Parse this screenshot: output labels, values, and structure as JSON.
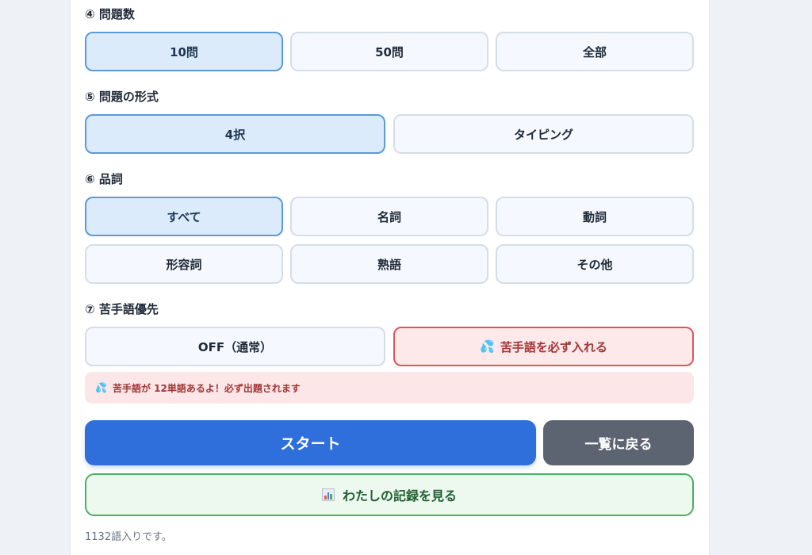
{
  "sections": {
    "count": {
      "title": "④ 問題数",
      "options": [
        "10問",
        "50問",
        "全部"
      ],
      "selected": "10問"
    },
    "format": {
      "title": "⑤ 問題の形式",
      "options": [
        "4択",
        "タイピング"
      ],
      "selected": "4択"
    },
    "pos": {
      "title": "⑥ 品詞",
      "options": [
        "すべて",
        "名詞",
        "動詞",
        "形容詞",
        "熟語",
        "その他"
      ],
      "selected": "すべて"
    },
    "weak": {
      "title": "⑦ 苦手語優先",
      "off_label": "OFF（通常）",
      "on_label": "苦手語を必ず入れる",
      "on_emoji": "💦",
      "selected": "on"
    }
  },
  "info": {
    "emoji": "💦",
    "text": "苦手語が 12単語あるよ！必ず出題されます"
  },
  "actions": {
    "start_label": "スタート",
    "back_label": "一覧に戻る",
    "records_label": "わたしの記録を見る",
    "records_icon": "bar-chart-icon"
  },
  "footer": {
    "text": "1132語入りです。"
  },
  "colors": {
    "selected_bg": "#dcebfc",
    "selected_border": "#5b9ad8",
    "weak_bg": "#fde9ea",
    "weak_border": "#d9575e",
    "start_bg": "#2f6fdc",
    "back_bg": "#5b6470",
    "records_border": "#4caf62"
  }
}
